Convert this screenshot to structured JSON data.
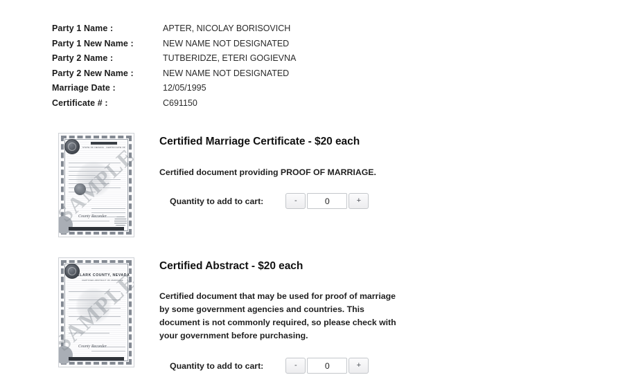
{
  "record": {
    "rows": [
      {
        "label": "Party 1 Name :",
        "value": "APTER, NICOLAY BORISOVICH"
      },
      {
        "label": "Party 1 New Name :",
        "value": "NEW NAME NOT DESIGNATED"
      },
      {
        "label": "Party 2 Name :",
        "value": "TUTBERIDZE, ETERI GOGIEVNA"
      },
      {
        "label": "Party 2 New Name :",
        "value": "NEW NAME NOT DESIGNATED"
      },
      {
        "label": "Marriage Date :",
        "value": "12/05/1995"
      },
      {
        "label": "Certificate # :",
        "value": "C691150"
      }
    ]
  },
  "products": [
    {
      "title": "Certified Marriage Certificate - $20 each",
      "description": "Certified document providing PROOF OF MARRIAGE.",
      "quantity_label": "Quantity to add to cart:",
      "quantity_value": "0",
      "decrement_label": "-",
      "increment_label": "+",
      "thumbnail": {
        "watermark": "SAMPLE",
        "heading": "",
        "subheading": "STATE OF NEVADA  ·  CERTIFICATE OF MARRIAGE",
        "signature": "County Recorder"
      }
    },
    {
      "title": "Certified Abstract - $20 each",
      "description": "Certified document that may be used for proof of marriage by some government agencies and countries. This document is not commonly required, so please check with your government before purchasing.",
      "quantity_label": "Quantity to add to cart:",
      "quantity_value": "0",
      "decrement_label": "-",
      "increment_label": "+",
      "thumbnail": {
        "watermark": "SAMPLE",
        "heading": "CLARK COUNTY, NEVADA",
        "subheading": "CERTIFIED ABSTRACT OF MARRIAGE",
        "signature": "County Recorder"
      }
    }
  ],
  "colors": {
    "page_background": "#ffffff",
    "text": "#1a1a1a",
    "button_face": "#ededef",
    "border": "#c3c6ca"
  }
}
